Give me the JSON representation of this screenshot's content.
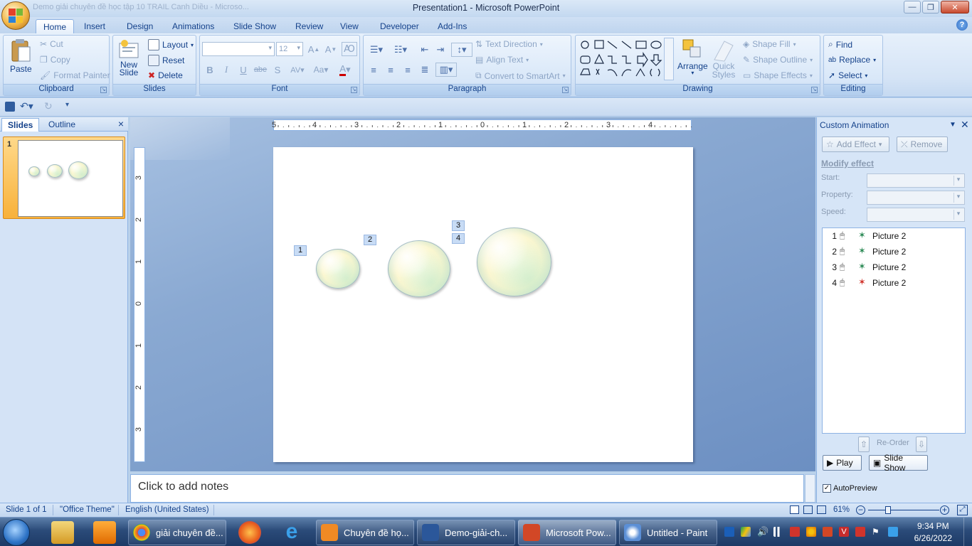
{
  "window": {
    "title": "Presentation1 - Microsoft PowerPoint",
    "bg_doc_title": "Demo giải chuyên đề học tập 10 TRAIL Canh Diều - Microso..."
  },
  "ribbon_tabs": [
    "Home",
    "Insert",
    "Design",
    "Animations",
    "Slide Show",
    "Review",
    "View",
    "Developer",
    "Add-Ins"
  ],
  "clipboard": {
    "paste": "Paste",
    "cut": "Cut",
    "copy": "Copy",
    "format_painter": "Format Painter",
    "label": "Clipboard"
  },
  "slides_group": {
    "layout": "Layout",
    "reset": "Reset",
    "new_slide_1": "New",
    "new_slide_2": "Slide",
    "delete": "Delete",
    "label": "Slides"
  },
  "font_group": {
    "font_size": "12",
    "label": "Font"
  },
  "paragraph_group": {
    "text_direction": "Text Direction",
    "align_text": "Align Text",
    "convert_smartart": "Convert to SmartArt",
    "label": "Paragraph"
  },
  "drawing_group": {
    "arrange": "Arrange",
    "quick_styles_1": "Quick",
    "quick_styles_2": "Styles",
    "shape_fill": "Shape Fill",
    "shape_outline": "Shape Outline",
    "shape_effects": "Shape Effects",
    "label": "Drawing"
  },
  "editing_group": {
    "find": "Find",
    "replace": "Replace",
    "select": "Select",
    "label": "Editing"
  },
  "left_panel": {
    "tab_slides": "Slides",
    "tab_outline": "Outline",
    "close": "×",
    "slide_number": "1"
  },
  "rulers": {
    "horizontal": [
      "5",
      "4",
      "3",
      "2",
      "1",
      "0",
      "1",
      "2",
      "3",
      "4"
    ],
    "vertical": [
      "3",
      "2",
      "1",
      "0",
      "1",
      "2",
      "3"
    ]
  },
  "slide": {
    "animation_tags": [
      "1",
      "2",
      "3",
      "4"
    ]
  },
  "notes": {
    "placeholder": "Click to add notes"
  },
  "custom_animation": {
    "title": "Custom Animation",
    "add_effect": "Add Effect",
    "remove": "Remove",
    "modify_effect": "Modify effect",
    "start_label": "Start:",
    "property_label": "Property:",
    "speed_label": "Speed:",
    "items": [
      {
        "num": "1",
        "name": "Picture 2",
        "effect": "entrance"
      },
      {
        "num": "2",
        "name": "Picture 2",
        "effect": "entrance"
      },
      {
        "num": "3",
        "name": "Picture 2",
        "effect": "entrance"
      },
      {
        "num": "4",
        "name": "Picture 2",
        "effect": "exit"
      }
    ],
    "reorder": "Re-Order",
    "play": "Play",
    "slide_show": "Slide Show",
    "autopreview": "AutoPreview",
    "autopreview_checked": true
  },
  "status_bar": {
    "slide_info": "Slide 1 of 1",
    "theme": "\"Office Theme\"",
    "language": "English (United States)",
    "zoom": "61%"
  },
  "taskbar": {
    "tasks": [
      {
        "label": "giải chuyên đề...",
        "icon_color": "#dd4b39"
      },
      {
        "label": "Chuyên đề họ...",
        "icon_color": "#f08a24"
      },
      {
        "label": "Demo-giải-ch...",
        "icon_color": "#2b579a"
      },
      {
        "label": "Microsoft Pow...",
        "icon_color": "#d24726"
      },
      {
        "label": "Untitled - Paint",
        "icon_color": "#5b8fd6"
      }
    ],
    "time": "9:34 PM",
    "date": "6/26/2022"
  },
  "colors": {
    "ribbon_text": "#15428b",
    "slide_bg_gradient": "#6c8fc2",
    "entrance_star": "#2e8b57",
    "exit_star": "#d0342c"
  }
}
